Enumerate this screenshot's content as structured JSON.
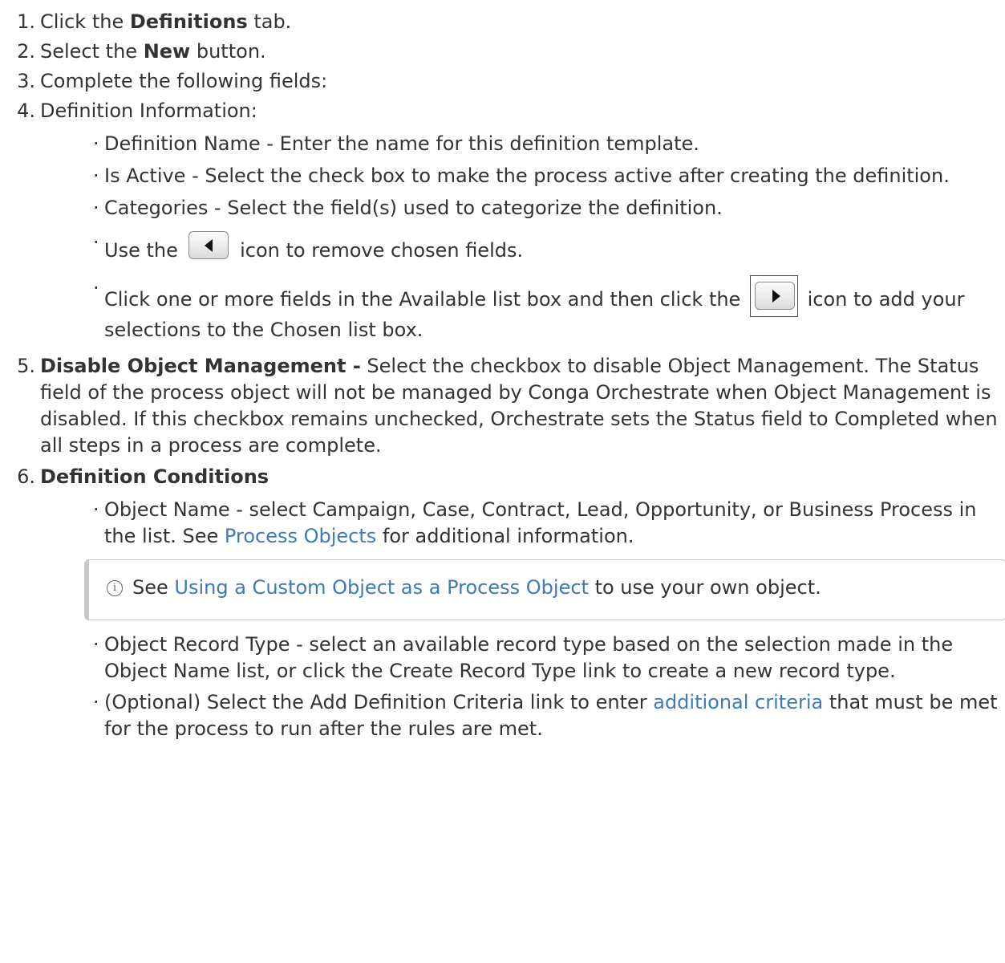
{
  "steps": [
    {
      "num": "1.",
      "pre": "Click the ",
      "bold": "Definitions",
      "post": " tab."
    },
    {
      "num": "2.",
      "pre": "Select the ",
      "bold": "New",
      "post": " button."
    },
    {
      "num": "3.",
      "text": "Complete the following fields:"
    },
    {
      "num": "4.",
      "text": "Definition Information:",
      "items": [
        "Definition Name - Enter the name for this definition template.",
        "Is Active - Select the check box to make the process active after creating the definition.",
        "Categories - Select the field(s) used to categorize the definition."
      ],
      "remove_item": {
        "pre": "Use the ",
        "icon": "move-left-icon",
        "post": " icon to remove chosen fields."
      },
      "add_item": {
        "pre": "Click one or more fields in the Available list box and then click the ",
        "icon": "move-right-icon",
        "post": " icon to add your selections to the Chosen list box."
      }
    },
    {
      "num": "5.",
      "bold": "Disable Object Management -",
      "text": " Select the checkbox to disable Object Management. The Status field of the process object will not be managed by Conga Orchestrate when Object Management is disabled. If this checkbox remains unchecked, Orchestrate sets the Status field to Completed when all steps in a process are complete."
    },
    {
      "num": "6.",
      "bold": "Definition Conditions",
      "object_name": {
        "pre": "Object Name - select Campaign, Case, Contract, Lead, Opportunity, or Business Process in the list. See ",
        "link": "Process Objects",
        "post": " for additional information."
      },
      "note": {
        "icon": "info-icon",
        "pre": "See ",
        "link": "Using a Custom Object as a Process Object",
        "post": " to use your own object."
      },
      "record_type": "Object Record Type - select an available record type based on the selection made in the Object Name list, or click the Create Record Type link to create a new record type.",
      "criteria": {
        "pre": "(Optional) Select the Add Definition Criteria link to enter ",
        "link": "additional criteria",
        "post": " that must be met for the process to run after the rules are met."
      }
    }
  ],
  "colors": {
    "text": "#333333",
    "link": "#3d7ab8",
    "note_border": "#c8c8c8"
  }
}
